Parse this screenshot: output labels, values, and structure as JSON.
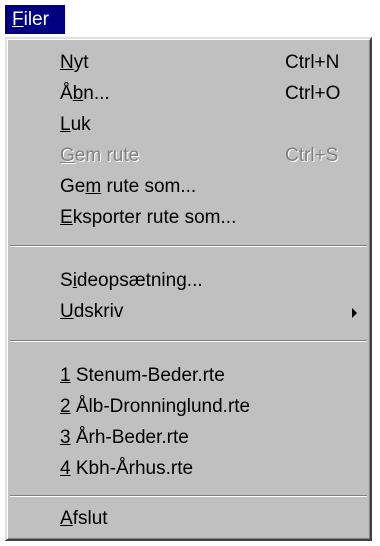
{
  "menubar": {
    "filer": {
      "pre": "",
      "key": "F",
      "post": "iler"
    }
  },
  "menu": {
    "items": [
      {
        "pre": "",
        "key": "N",
        "post": "yt",
        "shortcut": "Ctrl+N"
      },
      {
        "pre": "Å",
        "key": "b",
        "post": "n...",
        "shortcut": "Ctrl+O"
      },
      {
        "pre": "",
        "key": "L",
        "post": "uk",
        "shortcut": ""
      },
      {
        "pre": "",
        "key": "G",
        "post": "em rute",
        "shortcut": "Ctrl+S",
        "disabled": true
      },
      {
        "pre": "Ge",
        "key": "m",
        "post": " rute som...",
        "shortcut": ""
      },
      {
        "pre": "",
        "key": "E",
        "post": "ksporter rute som...",
        "shortcut": ""
      },
      {
        "pre": "S",
        "key": "i",
        "post": "deopsætning...",
        "shortcut": ""
      },
      {
        "pre": "",
        "key": "U",
        "post": "dskriv",
        "shortcut": "",
        "submenu": true
      },
      {
        "pre": "",
        "key": "1",
        "post": " Stenum-Beder.rte",
        "shortcut": ""
      },
      {
        "pre": "",
        "key": "2",
        "post": " Ålb-Dronninglund.rte",
        "shortcut": ""
      },
      {
        "pre": "",
        "key": "3",
        "post": " Årh-Beder.rte",
        "shortcut": ""
      },
      {
        "pre": "",
        "key": "4",
        "post": " Kbh-Århus.rte",
        "shortcut": ""
      },
      {
        "pre": "",
        "key": "A",
        "post": "fslut",
        "shortcut": ""
      }
    ]
  },
  "colors": {
    "menu_background": "#c0c0c0",
    "highlight": "#000080",
    "disabled_text": "#808080"
  },
  "icons": {
    "submenu_arrow": "submenu-arrow-icon"
  }
}
